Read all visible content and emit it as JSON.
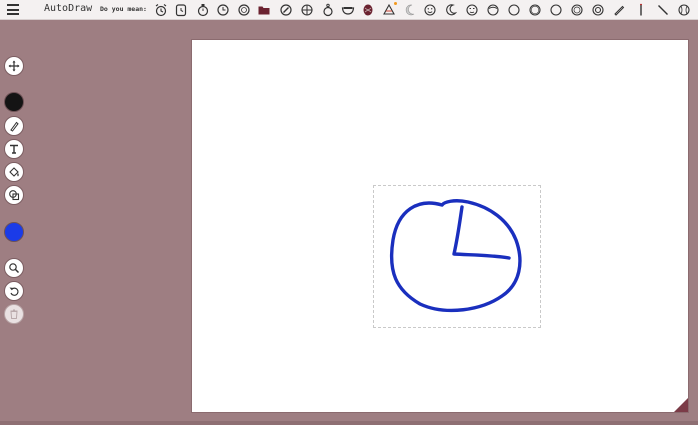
{
  "header": {
    "menu_icon": "hamburger-menu-icon",
    "title": "AutoDraw",
    "suggest_label": "Do you mean:"
  },
  "suggestions": [
    {
      "icon": "alarm-clock-icon"
    },
    {
      "icon": "clock-icon"
    },
    {
      "icon": "stopwatch-icon"
    },
    {
      "icon": "clock-face-icon"
    },
    {
      "icon": "wall-clock-icon"
    },
    {
      "icon": "folder-icon"
    },
    {
      "icon": "compass-icon"
    },
    {
      "icon": "target-icon"
    },
    {
      "icon": "pocket-watch-icon"
    },
    {
      "icon": "bowl-icon"
    },
    {
      "icon": "globe-icon"
    },
    {
      "icon": "pie-slice-icon",
      "badge": true
    },
    {
      "icon": "crescent-moon-icon"
    },
    {
      "icon": "smiley-face-icon"
    },
    {
      "icon": "moon-icon"
    },
    {
      "icon": "face-icon"
    },
    {
      "icon": "circle-icon"
    },
    {
      "icon": "ring-icon"
    },
    {
      "icon": "plate-icon"
    },
    {
      "icon": "circle-outline-icon"
    },
    {
      "icon": "record-icon"
    },
    {
      "icon": "concentric-circles-icon"
    },
    {
      "icon": "pencil-line-icon"
    },
    {
      "icon": "bar-icon"
    },
    {
      "icon": "diagonal-line-icon"
    },
    {
      "icon": "baseball-icon"
    }
  ],
  "tools": {
    "move": "move-icon",
    "active_fill_color": "#141414",
    "autodraw": "autodraw-icon",
    "draw": "pencil-icon",
    "type": "text-icon",
    "fill": "fill-bucket-icon",
    "shape": "shape-icon",
    "stroke_color": "#1a3be8",
    "zoom": "zoom-icon",
    "undo": "undo-icon",
    "delete": "trash-icon"
  },
  "colors": {
    "background": "#9e7e82",
    "stroke": "#1a2fbe",
    "corner": "#7b3b47"
  }
}
